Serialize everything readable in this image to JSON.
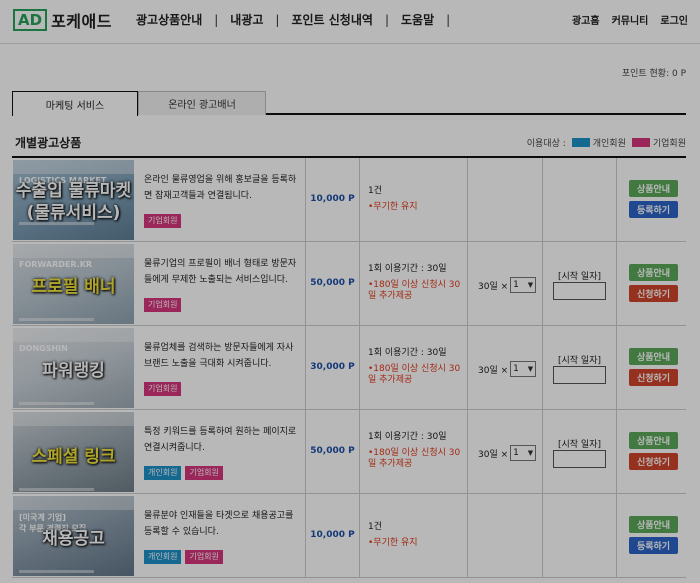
{
  "header": {
    "logo_badge": "AD",
    "logo_text": "포케애드",
    "nav": [
      "광고상품안내",
      "내광고",
      "포인트 신청내역",
      "도움말"
    ],
    "nav_sep": "|",
    "util": [
      "광고홈",
      "커뮤니티",
      "로그인"
    ]
  },
  "point_status": "포인트 현황: 0 P",
  "tabs": [
    "마케팅 서비스",
    "온라인 광고배너"
  ],
  "section": {
    "title": "개별광고상품",
    "legend_label": "이용대상 :",
    "legend": [
      {
        "label": "개인회원",
        "color": "#1e90c8"
      },
      {
        "label": "기업회원",
        "color": "#d6357d"
      }
    ]
  },
  "rows": [
    {
      "thumb_title": "수출입 물류마켓\n(물류서비스)",
      "thumb_caption": "LOGISTICS MARKET",
      "desc": "온라인 물류영업을 위해 홍보글을 등록하면 잠재고객들과 연결됩니다.",
      "badges": [
        "기업회원"
      ],
      "price": "10,000 P",
      "info_main": "1건",
      "info_note": "•무기한 유지",
      "qty": "",
      "qty_value": "",
      "date_label": "",
      "btn_info": "상품안내",
      "btn_action": "등록하기"
    },
    {
      "thumb_title": "프로필 배너",
      "thumb_caption": "FORWARDER.KR",
      "desc": "물류기업의 프로필이 배너 형태로 방문자들에게 무제한 노출되는 서비스입니다.",
      "badges": [
        "기업회원"
      ],
      "price": "50,000 P",
      "info_main": "1회 이용기간 : 30일",
      "info_note": "•180일 이상 신청시 30일 추가제공",
      "qty": "30일 ×",
      "qty_value": "1",
      "date_label": "[시작 일자]",
      "btn_info": "상품안내",
      "btn_action": "신청하기"
    },
    {
      "thumb_title": "파워랭킹",
      "thumb_caption": "DONGSHIN",
      "desc": "물류업체를 검색하는 방문자들에게 자사 브랜드 노출을 극대화 시켜줍니다.",
      "badges": [
        "기업회원"
      ],
      "price": "30,000 P",
      "info_main": "1회 이용기간 : 30일",
      "info_note": "•180일 이상 신청시 30일 추가제공",
      "qty": "30일 ×",
      "qty_value": "1",
      "date_label": "[시작 일자]",
      "btn_info": "상품안내",
      "btn_action": "신청하기"
    },
    {
      "thumb_title": "스페셜 링크",
      "thumb_caption": "",
      "desc": "특정 키워드를 등록하여 원하는 페이지로 연결시켜줍니다.",
      "badges": [
        "개인회원",
        "기업회원"
      ],
      "price": "50,000 P",
      "info_main": "1회 이용기간 : 30일",
      "info_note": "•180일 이상 신청시 30일 추가제공",
      "qty": "30일 ×",
      "qty_value": "1",
      "date_label": "[시작 일자]",
      "btn_info": "상품안내",
      "btn_action": "신청하기"
    },
    {
      "thumb_title": "채용공고",
      "thumb_caption": "[미국계 기업]\n각 부문 경력직 모집",
      "desc": "물류분야 인재들을 타겟으로 채용공고를 등록할 수 있습니다.",
      "badges": [
        "개인회원",
        "기업회원"
      ],
      "price": "10,000 P",
      "info_main": "1건",
      "info_note": "•무기한 유지",
      "qty": "",
      "qty_value": "",
      "date_label": "",
      "btn_info": "상품안내",
      "btn_action": "등록하기"
    }
  ]
}
